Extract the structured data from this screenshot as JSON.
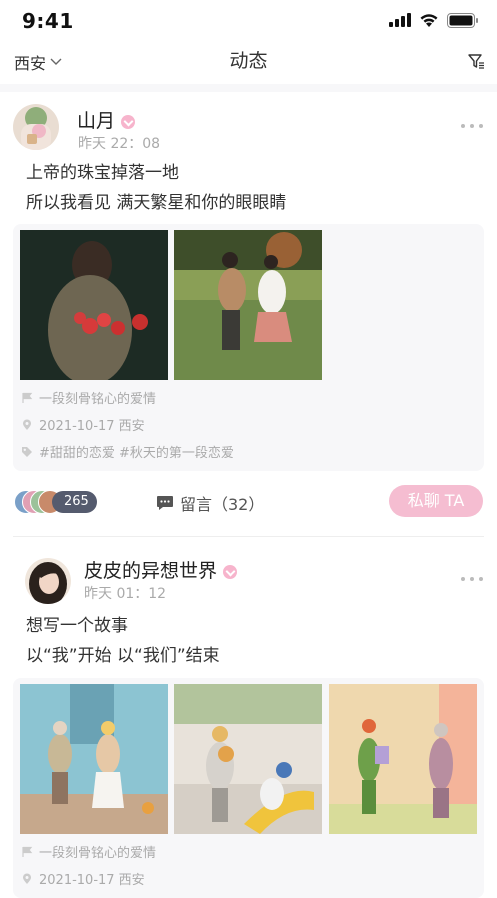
{
  "status_bar": {
    "time": "9:41"
  },
  "header": {
    "city": "西安",
    "title": "动态"
  },
  "posts": [
    {
      "username": "山月",
      "time": "昨天 22：08",
      "text_lines": [
        "上帝的珠宝掉落一地",
        "所以我看见 满天繁星和你的眼眼睛"
      ],
      "topic": "一段刻骨铭心的爱情",
      "date_location": "2021-10-17   西安",
      "tags": "#甜甜的恋爱 #秋天的第一段恋爱",
      "like_count": "265",
      "comment_label": "留言（32）",
      "chat_label": "私聊 TA"
    },
    {
      "username": "皮皮的异想世界",
      "time": "昨天 01：12",
      "text_lines": [
        "想写一个故事",
        "以“我”开始  以“我们”结束"
      ],
      "topic": "一段刻骨铭心的爱情",
      "date_location": "2021-10-17   西安"
    }
  ]
}
